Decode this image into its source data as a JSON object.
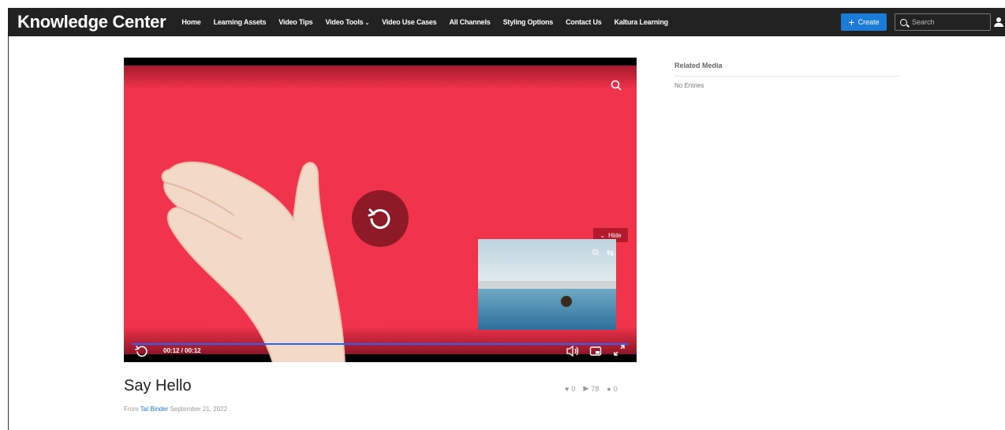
{
  "header": {
    "brand": "Knowledge Center",
    "nav": [
      {
        "label": "Home"
      },
      {
        "label": "Learning Assets"
      },
      {
        "label": "Video Tips"
      },
      {
        "label": "Video Tools",
        "caret": "⌄"
      },
      {
        "label": "Video Use Cases"
      },
      {
        "label": "All Channels"
      },
      {
        "label": "Styling Options"
      },
      {
        "label": "Contact Us"
      },
      {
        "label": "Kaltura Learning"
      }
    ],
    "create_label": "Create",
    "search_placeholder": "Search"
  },
  "player": {
    "time": "00:12 / 00:12",
    "progress": 1.0,
    "hide_label": "Hide",
    "colors": {
      "video_bg": "#f1344c",
      "replay_bg": "#8e1a28",
      "progress": "#2962ff"
    },
    "icons": [
      "zoom-icon",
      "replay-icon",
      "volume-icon",
      "pip-icon",
      "fullscreen-icon",
      "pip-expand-icon",
      "pip-swap-icon"
    ]
  },
  "media": {
    "title": "Say Hello",
    "likes": "0",
    "plays": "78",
    "comments": "0",
    "from_label": "From",
    "author": "Tal Binder",
    "date": "September 21, 2022"
  },
  "related": {
    "title": "Related Media",
    "empty": "No Entries"
  },
  "accent_color": "#1a7bd8"
}
